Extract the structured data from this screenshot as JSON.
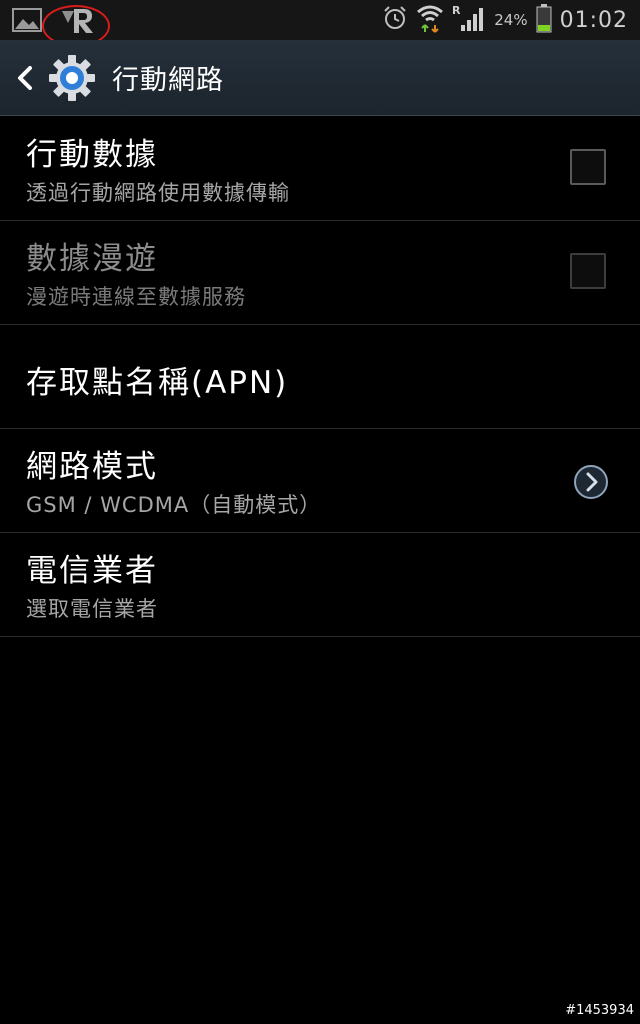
{
  "status_bar": {
    "battery_percent": "24%",
    "time": "01:02",
    "roaming_indicator": "R",
    "icons": [
      "gallery-icon",
      "roaming-app-icon",
      "alarm-icon",
      "wifi-icon",
      "signal-icon",
      "battery-icon"
    ]
  },
  "action_bar": {
    "title": "行動網路",
    "icons": [
      "back-icon",
      "settings-gear-icon"
    ]
  },
  "settings": [
    {
      "title": "行動數據",
      "summary": "透過行動網路使用數據傳輸",
      "control": "checkbox",
      "checked": false,
      "enabled": true
    },
    {
      "title": "數據漫遊",
      "summary": "漫遊時連線至數據服務",
      "control": "checkbox",
      "checked": false,
      "enabled": false
    },
    {
      "title": "存取點名稱(APN)",
      "summary": "",
      "control": "none",
      "enabled": true
    },
    {
      "title": "網路模式",
      "summary": "GSM / WCDMA（自動模式）",
      "control": "chevron",
      "enabled": true
    },
    {
      "title": "電信業者",
      "summary": "選取電信業者",
      "control": "none",
      "enabled": true
    }
  ],
  "watermark": "#1453934",
  "colors": {
    "action_bar": "#25303b",
    "gear_blue": "#2f7fd8",
    "annotation": "#d81c1c",
    "battery_level": "#7fd321"
  }
}
